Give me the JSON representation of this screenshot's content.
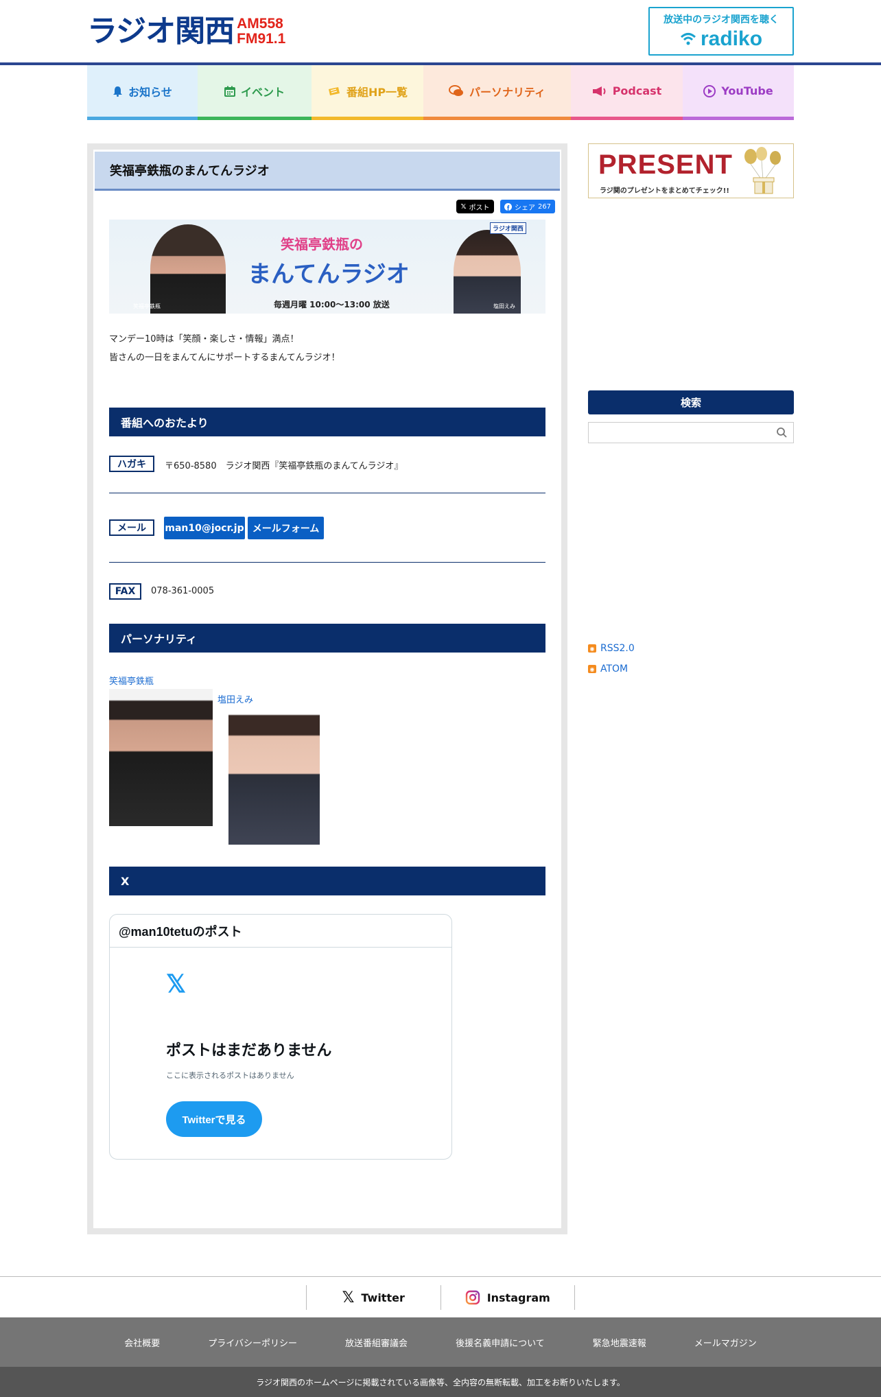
{
  "header": {
    "logo_text": "ラジオ関西",
    "logo_am": "AM558",
    "logo_fm": "FM91.1",
    "radiko_caption": "放送中のラジオ関西を聴く",
    "radiko_label": "radiko"
  },
  "nav": [
    {
      "label": "お知らせ",
      "icon": "bell-icon",
      "color": "#1a74c9",
      "bg": "#dff0fb",
      "border": "#4aa8e0"
    },
    {
      "label": "イベント",
      "icon": "calendar-icon",
      "color": "#2d9a4d",
      "bg": "#e4f6e7",
      "border": "#3cb55a"
    },
    {
      "label": "番組HP一覧",
      "icon": "ticket-icon",
      "color": "#e0a21a",
      "bg": "#fdf6dc",
      "border": "#f2b92b"
    },
    {
      "label": "パーソナリティ",
      "icon": "chat-icon",
      "color": "#e0651a",
      "bg": "#fde9dc",
      "border": "#f08a3d"
    },
    {
      "label": "Podcast",
      "icon": "megaphone-icon",
      "color": "#d6336c",
      "bg": "#fce4ec",
      "border": "#e8578b"
    },
    {
      "label": "YouTube",
      "icon": "play-icon",
      "color": "#9c3cc4",
      "bg": "#f4e1fa",
      "border": "#bb6ad9"
    }
  ],
  "page": {
    "title": "笑福亭鉄瓶のまんてんラジオ",
    "share_x": "ポスト",
    "share_fb_label": "シェア",
    "share_fb_count": "267",
    "banner": {
      "title_line1": "笑福亭鉄瓶の",
      "title_line2": "まんてんラジオ",
      "schedule": "毎週月曜 10:00〜13:00 放送",
      "cap_left": "笑福亭鉄瓶",
      "cap_right": "塩田えみ",
      "station": "ラジオ関西"
    },
    "desc_line1": "マンデー10時は「笑顔・楽しさ・情報」満点！",
    "desc_line2": "皆さんの一日をまんてんにサポートするまんてんラジオ！"
  },
  "letters": {
    "heading": "番組へのおたより",
    "postcard_tag": "ハガキ",
    "postcard_text": "〒650-8580　ラジオ関西『笑福亭鉄瓶のまんてんラジオ』",
    "mail_tag": "メール",
    "mail_address": "man10@jocr.jp",
    "mail_form": "メールフォーム",
    "fax_tag": "FAX",
    "fax_number": "078-361-0005"
  },
  "personality": {
    "heading": "パーソナリティ",
    "p1": "笑福亭鉄瓶",
    "p2": "塩田えみ"
  },
  "x_section": {
    "heading": "X",
    "handle": "@man10tetuのポスト",
    "big_text": "ポストはまだありません",
    "small_text": "ここに表示されるポストはありません",
    "button": "Twitterで見る"
  },
  "sidebar": {
    "present_title": "PRESENT",
    "present_sub": "ラジ関のプレゼントをまとめてチェック!!",
    "search_heading": "検索",
    "search_placeholder": "",
    "feeds": [
      "RSS2.0",
      "ATOM"
    ]
  },
  "footer": {
    "social": [
      {
        "label": "Twitter",
        "icon": "x-icon"
      },
      {
        "label": "Instagram",
        "icon": "instagram-icon"
      }
    ],
    "links": [
      "会社概要",
      "プライバシーポリシー",
      "放送番組審議会",
      "後援名義申請について",
      "緊急地震速報",
      "メールマガジン"
    ],
    "copyright": "ラジオ関西のホームページに掲載されている画像等、全内容の無断転載、加工をお断りいたします。"
  }
}
